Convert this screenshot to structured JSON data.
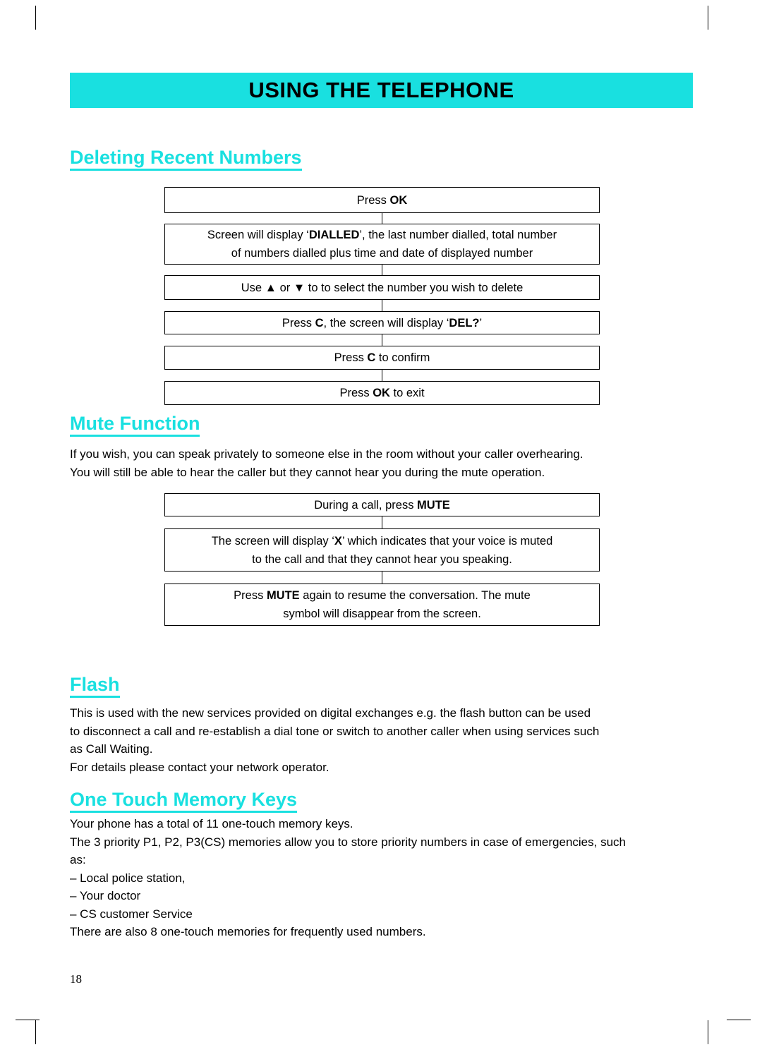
{
  "header": {
    "banner_title": "USING THE TELEPHONE"
  },
  "sections": {
    "deleting": {
      "heading": "Deleting Recent Numbers",
      "steps": [
        {
          "html": "Press <b>OK</b>"
        },
        {
          "html": "Screen will display &lsquo;<b>DIALLED</b>&rsquo;, the last number dialled, total number<br>of numbers dialled plus time and date of displayed number"
        },
        {
          "html": "Use &#9650; or &#9660; to to select the number you wish to delete"
        },
        {
          "html": "Press <b>C</b>, the screen will display &lsquo;<b>DEL?</b>&rsquo;"
        },
        {
          "html": "Press <b>C</b> to confirm"
        },
        {
          "html": "Press <b>OK</b> to exit"
        }
      ]
    },
    "mute": {
      "heading": "Mute Function",
      "paragraph_lines": [
        "If you wish, you can speak privately to someone else in the room without your caller overhearing.",
        "You will still be able to hear the caller but they cannot hear you during the mute operation."
      ],
      "steps": [
        {
          "html": "During a call, press <b>MUTE</b>"
        },
        {
          "html": "The screen will display &lsquo;<b>X</b>&rsquo; which indicates that your voice is muted<br>to the call and that they cannot hear you speaking."
        },
        {
          "html": "Press <b>MUTE</b> again to resume the conversation. The mute<br>symbol will disappear from the screen."
        }
      ]
    },
    "flash": {
      "heading": "Flash",
      "paragraph_lines": [
        "This is used with the new services provided on digital exchanges e.g. the flash button can be used",
        "to disconnect a call and re-establish a dial tone or switch to another caller when using services such",
        "as Call Waiting.",
        "For details please contact your network operator."
      ]
    },
    "one_touch": {
      "heading": "One Touch Memory Keys",
      "paragraph_lines": [
        "Your phone has a total of 11 one-touch memory keys.",
        "The 3 priority P1, P2, P3(CS) memories allow you to store priority numbers in case of emergencies, such",
        "as:",
        "&ndash; Local police station,",
        "&ndash; Your doctor",
        "&ndash; CS customer Service",
        "There are also 8 one-touch memories for frequently used numbers."
      ]
    }
  },
  "footer": {
    "page_number": "18"
  },
  "colors": {
    "accent": "#19e0e0",
    "text": "#000000",
    "background": "#ffffff"
  }
}
